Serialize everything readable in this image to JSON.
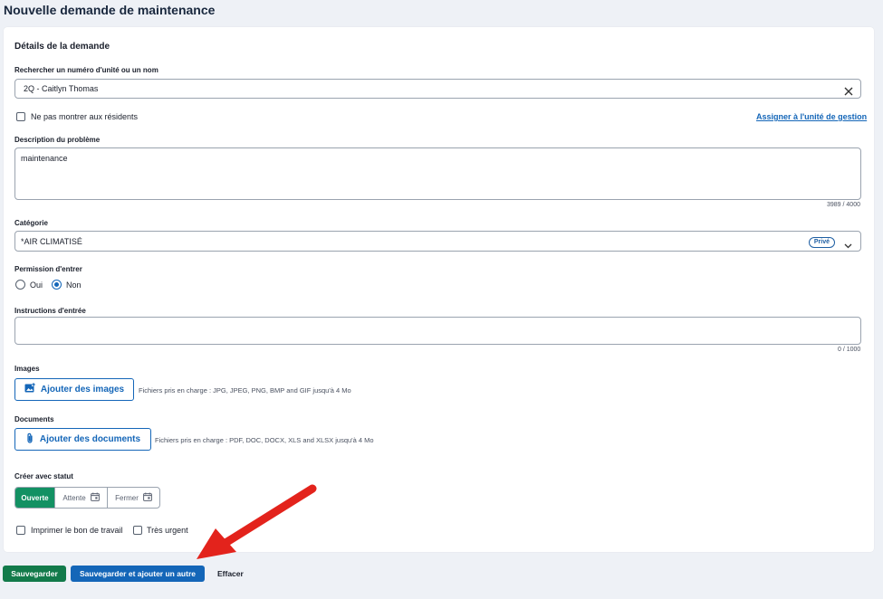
{
  "page": {
    "title": "Nouvelle demande de maintenance"
  },
  "form": {
    "section_title": "Détails de la demande",
    "unit_search": {
      "label": "Rechercher un numéro d'unité ou un nom",
      "value": "2Q - Caitlyn Thomas"
    },
    "hide_from_residents": {
      "label": "Ne pas montrer aux résidents",
      "checked": false
    },
    "assign_link": "Assigner à l'unité de gestion",
    "description": {
      "label": "Description du problème",
      "value": "maintenance",
      "counter": "3989 / 4000"
    },
    "category": {
      "label": "Catégorie",
      "value": "*AIR CLIMATISÉ",
      "badge": "Privé"
    },
    "entry_permission": {
      "label": "Permission d'entrer",
      "options": [
        {
          "label": "Oui",
          "selected": false
        },
        {
          "label": "Non",
          "selected": true
        }
      ]
    },
    "entry_instructions": {
      "label": "Instructions d'entrée",
      "value": "",
      "counter": "0 / 1000"
    },
    "images": {
      "label": "Images",
      "button": "Ajouter des images",
      "hint": "Fichiers pris en charge : JPG, JPEG, PNG, BMP and GIF jusqu'à 4 Mo"
    },
    "documents": {
      "label": "Documents",
      "button": "Ajouter des documents",
      "hint": "Fichiers pris en charge : PDF, DOC, DOCX, XLS and XLSX jusqu'à 4 Mo"
    },
    "status": {
      "label": "Créer avec statut",
      "options": [
        {
          "label": "Ouverte",
          "active": true
        },
        {
          "label": "Attente",
          "active": false
        },
        {
          "label": "Fermer",
          "active": false
        }
      ]
    },
    "print_work_order": {
      "label": "Imprimer le bon de travail",
      "checked": false
    },
    "very_urgent": {
      "label": "Très urgent",
      "checked": false
    }
  },
  "actions": {
    "save": "Sauvegarder",
    "save_add": "Sauvegarder et ajouter un autre",
    "clear": "Effacer"
  },
  "colors": {
    "primary": "#1466b8",
    "success": "#139163",
    "save": "#127a4a",
    "annotation_arrow": "#e3231c"
  }
}
